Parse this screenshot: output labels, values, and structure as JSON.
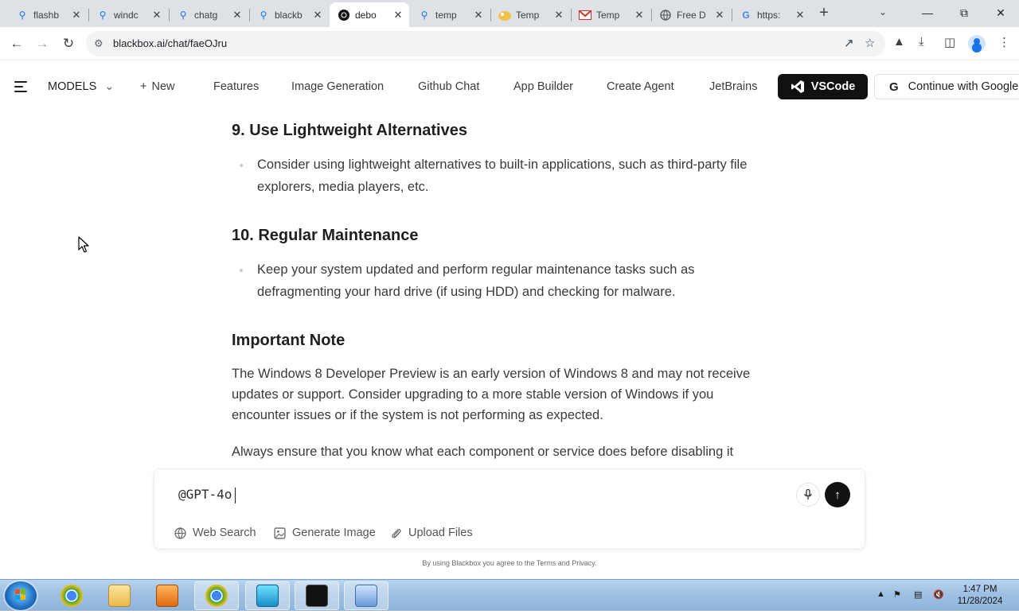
{
  "browser": {
    "tabs": [
      {
        "title": "flashb",
        "icon": "search-icon",
        "active": false
      },
      {
        "title": "windc",
        "icon": "search-icon",
        "active": false
      },
      {
        "title": "chatg",
        "icon": "search-icon",
        "active": false
      },
      {
        "title": "blackb",
        "icon": "search-icon",
        "active": false
      },
      {
        "title": "debo",
        "icon": "blackbox-icon",
        "active": true
      },
      {
        "title": "temp",
        "icon": "search-icon",
        "active": false
      },
      {
        "title": "Temp",
        "icon": "temp-mail-icon",
        "active": false
      },
      {
        "title": "Temp",
        "icon": "gmail-icon",
        "active": false
      },
      {
        "title": "Free D",
        "icon": "globe-icon",
        "active": false
      },
      {
        "title": "https:",
        "icon": "google-icon",
        "active": false
      }
    ],
    "url": "blackbox.ai/chat/faeOJru"
  },
  "site_nav": {
    "models_label": "MODELS",
    "new_label": "New",
    "links": [
      "Features",
      "Image Generation",
      "Github Chat",
      "App Builder",
      "Create Agent",
      "JetBrains"
    ],
    "vscode_label": "VSCode",
    "google_label": "Continue with Google"
  },
  "content": {
    "h9": "9. Use Lightweight Alternatives",
    "b9": "Consider using lightweight alternatives to built-in applications, such as third-party file explorers, media players, etc.",
    "h10": "10. Regular Maintenance",
    "b10": "Keep your system updated and perform regular maintenance tasks such as defragmenting your hard drive (if using HDD) and checking for malware.",
    "note_heading": "Important Note",
    "note_text": "The Windows 8 Developer Preview is an early version of Windows 8 and may not receive updates or support. Consider upgrading to a more stable version of Windows if you encounter issues or if the system is not performing as expected.",
    "closing_text": "Always ensure that you know what each component or service does before disabling it"
  },
  "composer": {
    "input_value": "@GPT-4o",
    "tools": [
      "Web Search",
      "Generate Image",
      "Upload Files"
    ],
    "footnote": "By using Blackbox you agree to the Terms and Privacy."
  },
  "taskbar": {
    "time": "1:47 PM",
    "date": "11/28/2024"
  },
  "colors": {
    "vscode_button": "#111111",
    "send_button": "#111111",
    "taskbar": "#9fc0e3"
  }
}
